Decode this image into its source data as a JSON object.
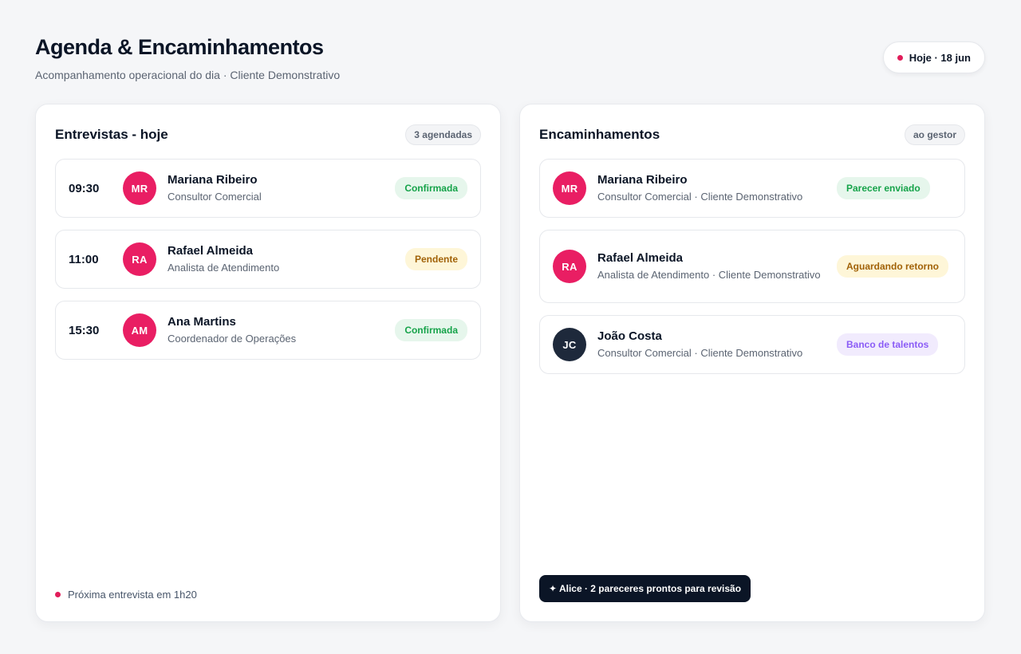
{
  "header": {
    "title": "Agenda & Encaminhamentos",
    "subtitle": "Acompanhamento operacional do dia · Cliente Demonstrativo",
    "date_label": "Hoje · 18 jun"
  },
  "colors": {
    "accent": "#e91e63",
    "dark": "#0b1526",
    "status_green": "#16a34a",
    "status_yellow": "#a16207",
    "status_purple": "#8b5cf6"
  },
  "interviews": {
    "title": "Entrevistas - hoje",
    "count_label": "3 agendadas",
    "items": [
      {
        "time": "09:30",
        "initials": "MR",
        "name": "Mariana Ribeiro",
        "role": "Consultor Comercial",
        "status": "Confirmada"
      },
      {
        "time": "11:00",
        "initials": "RA",
        "name": "Rafael Almeida",
        "role": "Analista de Atendimento",
        "status": "Pendente"
      },
      {
        "time": "15:30",
        "initials": "AM",
        "name": "Ana Martins",
        "role": "Coordenador de Operações",
        "status": "Confirmada"
      }
    ],
    "footer_note": "Próxima entrevista em 1h20"
  },
  "referrals": {
    "title": "Encaminhamentos",
    "count_label": "ao gestor",
    "items": [
      {
        "initials": "MR",
        "name": "Mariana Ribeiro",
        "role": "Consultor Comercial · Cliente Demonstrativo",
        "status": "Parecer enviado"
      },
      {
        "initials": "RA",
        "name": "Rafael Almeida",
        "role": "Analista de Atendimento · Cliente Demonstrativo",
        "status": "Aguardando retorno"
      },
      {
        "initials": "JC",
        "name": "João Costa",
        "role": "Consultor Comercial · Cliente Demonstrativo",
        "status": "Banco de talentos"
      }
    ],
    "assistant_note": "✦ Alice · 2 pareceres prontos para revisão"
  }
}
